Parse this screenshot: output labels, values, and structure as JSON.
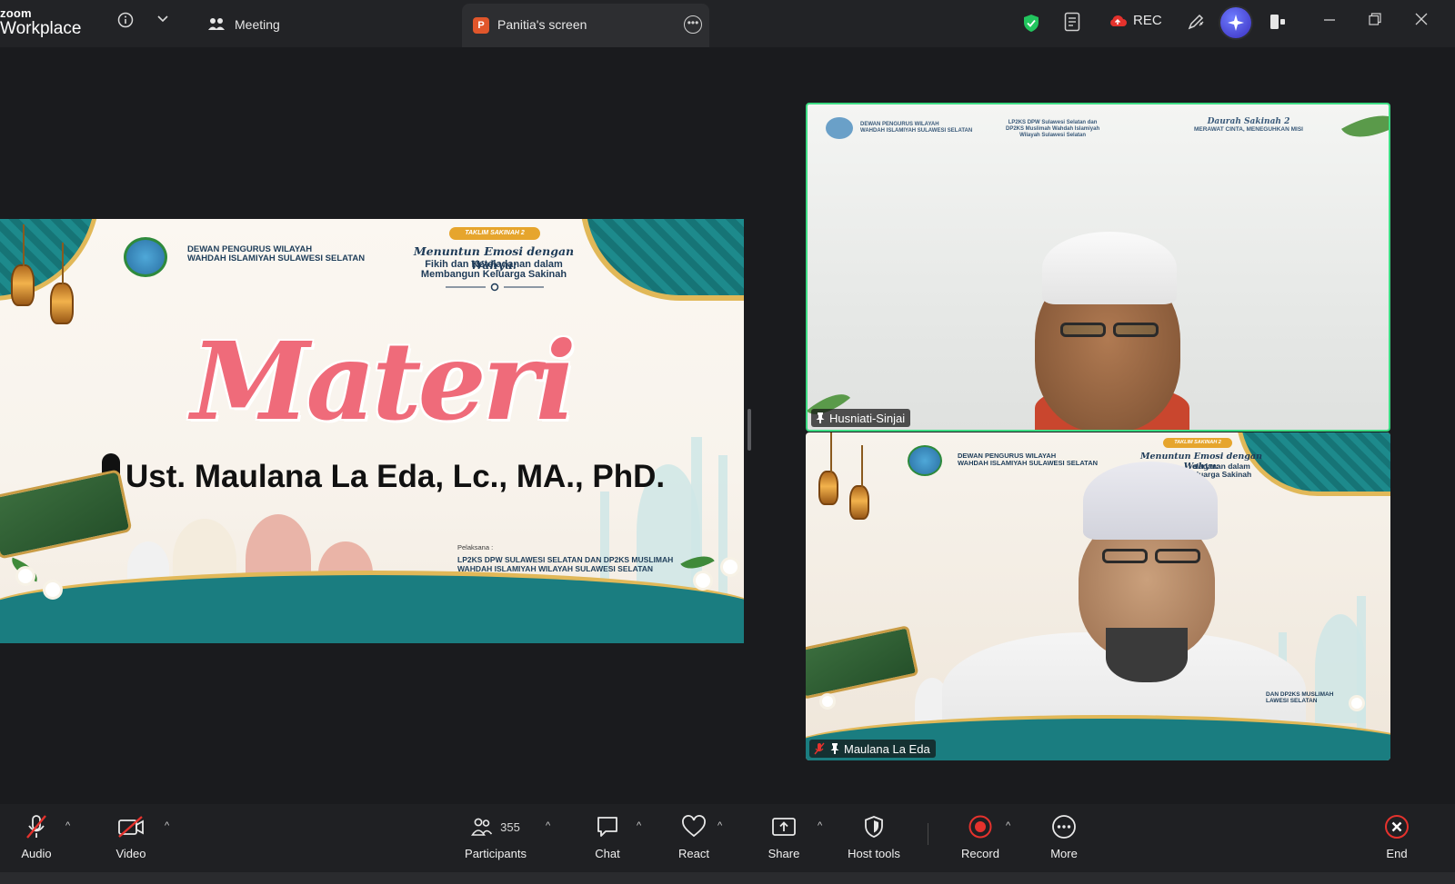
{
  "app": {
    "brand_top": "zoom",
    "brand_bottom": "Workplace",
    "meeting_tab_label": "Meeting",
    "screen_tab_badge": "P",
    "screen_tab_label": "Panitia's screen",
    "rec_label": "REC",
    "accent": "#3ddc84",
    "record_red": "#e5322d"
  },
  "slide": {
    "org_line1": "DEWAN PENGURUS WILAYAH",
    "org_line2": "WAHDAH ISLAMIYAH SULAWESI SELATAN",
    "badge": "TAKLIM SAKINAH 2",
    "theme_title": "Menuntun Emosi dengan Wahyu:",
    "theme_sub1": "Fikih dan Keteladanan dalam",
    "theme_sub2": "Membangun Keluarga Sakinah",
    "headline": "Materi",
    "speaker": "Ust. Maulana La Eda, Lc., MA., PhD.",
    "pelaksana_label": "Pelaksana :",
    "pelaksana_line1": "LP2KS DPW SULAWESI SELATAN DAN DP2KS MUSLIMAH",
    "pelaksana_line2": "WAHDAH ISLAMIYAH WILAYAH SULAWESI SELATAN"
  },
  "tiles": [
    {
      "name": "Husniati-Sinjai",
      "header_left1": "DEWAN PENGURUS WILAYAH",
      "header_left2": "WAHDAH ISLAMIYAH SULAWESI SELATAN",
      "header_mid1": "LP2KS DPW Sulawesi Selatan dan",
      "header_mid2": "DP2KS Muslimah Wahdah Islamiyah",
      "header_mid3": "Wilayah Sulawesi Selatan",
      "header_right1": "Daurah Sakinah 2",
      "header_right2": "MERAWAT CINTA, MENEGUHKAN MISI",
      "pinned": true,
      "active_speaker": true
    },
    {
      "name": "Maulana La Eda",
      "header_left1": "DEWAN PENGURUS WILAYAH",
      "header_left2": "WAHDAH ISLAMIYAH SULAWESI SELATAN",
      "badge": "TAKLIM SAKINAH 2",
      "theme_title": "Menuntun Emosi dengan Wahyu:",
      "theme_sub1": "eladanan dalam",
      "theme_sub2": "eluarga Sakinah",
      "footer1": "DAN DP2KS MUSLIMAH",
      "footer2": "LAWESI SELATAN",
      "pinned": true,
      "muted": true
    }
  ],
  "toolbar": {
    "audio": "Audio",
    "video": "Video",
    "participants_count": "355",
    "participants": "Participants",
    "chat": "Chat",
    "react": "React",
    "share": "Share",
    "host_tools": "Host tools",
    "record": "Record",
    "more": "More",
    "end": "End"
  }
}
